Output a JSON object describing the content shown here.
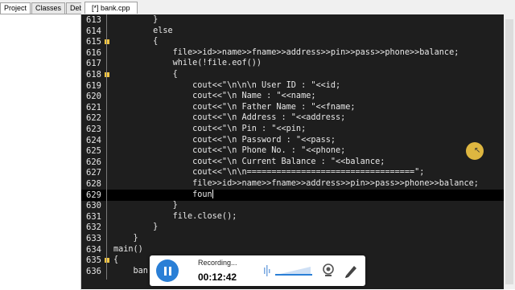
{
  "left_panel": {
    "tabs": [
      "Project",
      "Classes",
      "Debug"
    ],
    "active_tab": "Project"
  },
  "editor": {
    "tab_label": "[*] bank.cpp",
    "current_line": 629,
    "lines": [
      {
        "n": 613,
        "code": "        }",
        "fold": false
      },
      {
        "n": 614,
        "code": "        else",
        "fold": false
      },
      {
        "n": 615,
        "code": "        {",
        "fold": true
      },
      {
        "n": 616,
        "code": "            file>>id>>name>>fname>>address>>pin>>pass>>phone>>balance;",
        "fold": false
      },
      {
        "n": 617,
        "code": "            while(!file.eof())",
        "fold": false
      },
      {
        "n": 618,
        "code": "            {",
        "fold": true
      },
      {
        "n": 619,
        "code": "                cout<<\"\\n\\n\\n User ID : \"<<id;",
        "fold": false
      },
      {
        "n": 620,
        "code": "                cout<<\"\\n Name : \"<<name;",
        "fold": false
      },
      {
        "n": 621,
        "code": "                cout<<\"\\n Father Name : \"<<fname;",
        "fold": false
      },
      {
        "n": 622,
        "code": "                cout<<\"\\n Address : \"<<address;",
        "fold": false
      },
      {
        "n": 623,
        "code": "                cout<<\"\\n Pin : \"<<pin;",
        "fold": false
      },
      {
        "n": 624,
        "code": "                cout<<\"\\n Password : \"<<pass;",
        "fold": false
      },
      {
        "n": 625,
        "code": "                cout<<\"\\n Phone No. : \"<<phone;",
        "fold": false
      },
      {
        "n": 626,
        "code": "                cout<<\"\\n Current Balance : \"<<balance;",
        "fold": false
      },
      {
        "n": 627,
        "code": "                cout<<\"\\n\\n==================================\";",
        "fold": false
      },
      {
        "n": 628,
        "code": "                file>>id>>name>>fname>>address>>pin>>pass>>phone>>balance;",
        "fold": false
      },
      {
        "n": 629,
        "code": "                foun",
        "fold": false
      },
      {
        "n": 630,
        "code": "            }",
        "fold": false
      },
      {
        "n": 631,
        "code": "            file.close();",
        "fold": false
      },
      {
        "n": 632,
        "code": "        }",
        "fold": false
      },
      {
        "n": 633,
        "code": "    }",
        "fold": false
      },
      {
        "n": 634,
        "code": "main()",
        "fold": false
      },
      {
        "n": 635,
        "code": "{",
        "fold": true
      },
      {
        "n": 636,
        "code": "    ban",
        "fold": false
      }
    ]
  },
  "recorder": {
    "status": "Recording...",
    "time": "00:12:42"
  },
  "colors": {
    "editor_bg": "#1e1e1e",
    "fold_marker": "#f5c542",
    "record_button": "#2a7fd6"
  }
}
